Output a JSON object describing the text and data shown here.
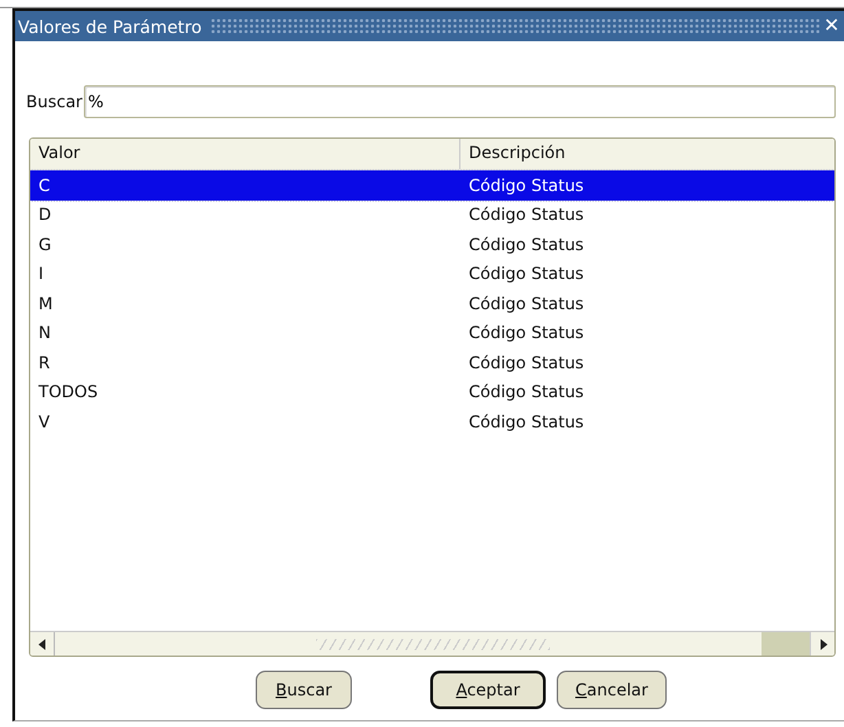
{
  "window": {
    "title": "Valores de Parámetro",
    "close": "✕"
  },
  "search": {
    "label": "Buscar",
    "value": "%"
  },
  "table": {
    "columns": [
      "Valor",
      "Descripción"
    ],
    "rows": [
      {
        "cells": [
          "C",
          "Código Status"
        ],
        "selected": true
      },
      {
        "cells": [
          "D",
          "Código Status"
        ],
        "selected": false
      },
      {
        "cells": [
          "G",
          "Código Status"
        ],
        "selected": false
      },
      {
        "cells": [
          "I",
          "Código Status"
        ],
        "selected": false
      },
      {
        "cells": [
          "M",
          "Código Status"
        ],
        "selected": false
      },
      {
        "cells": [
          "N",
          "Código Status"
        ],
        "selected": false
      },
      {
        "cells": [
          "R",
          "Código Status"
        ],
        "selected": false
      },
      {
        "cells": [
          "TODOS",
          "Código Status"
        ],
        "selected": false
      },
      {
        "cells": [
          "V",
          "Código Status"
        ],
        "selected": false
      }
    ]
  },
  "buttons": [
    {
      "label": "Buscar",
      "default": false,
      "underline_first": true
    },
    {
      "label": "Aceptar",
      "default": true,
      "underline_first": true
    },
    {
      "label": "Cancelar",
      "default": false,
      "underline_first": true
    }
  ]
}
